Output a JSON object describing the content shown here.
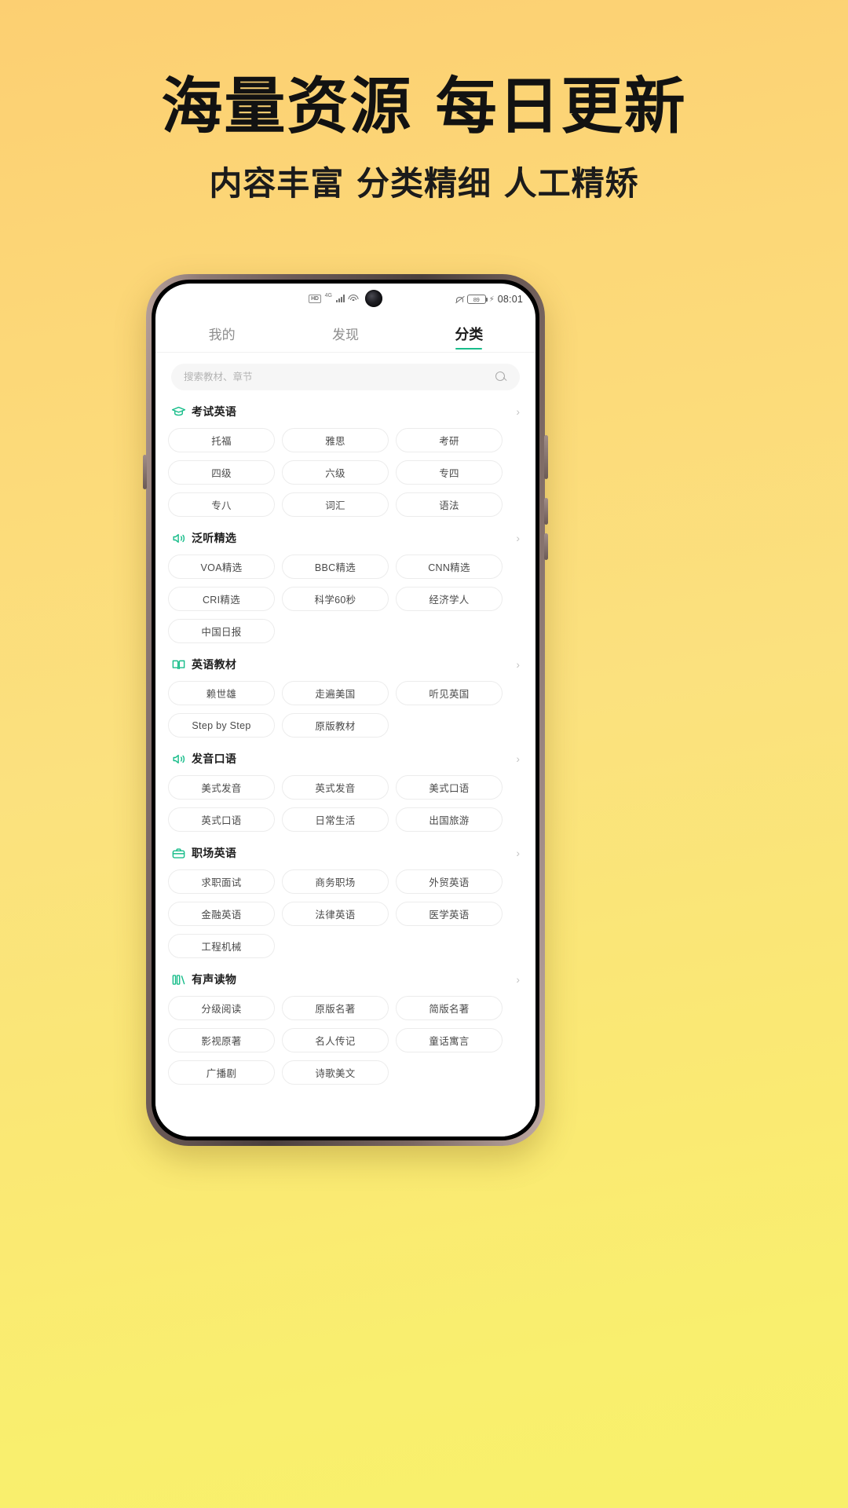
{
  "promo": {
    "title": "海量资源 每日更新",
    "subtitle": "内容丰富 分类精细 人工精矫",
    "bg_start": "#fccf72",
    "bg_end": "#f8f06a"
  },
  "statusbar": {
    "hd_badge": "HD",
    "network": "4G",
    "battery_percent": "89",
    "charging_icon": "⚡",
    "time": "08:01",
    "mute_icon": "mute-icon",
    "wifi_icon": "wifi-icon",
    "camera_icon": "front-camera"
  },
  "tabs": [
    {
      "label": "我的",
      "active": false
    },
    {
      "label": "发现",
      "active": false
    },
    {
      "label": "分类",
      "active": true
    }
  ],
  "accent_color": "#18bd8a",
  "search": {
    "placeholder": "搜索教材、章节",
    "value": "",
    "icon": "search-icon"
  },
  "sections": [
    {
      "title": "考试英语",
      "icon": "graduation-cap-icon",
      "arrow": "›",
      "chips": [
        "托福",
        "雅思",
        "考研",
        "四级",
        "六级",
        "专四",
        "专八",
        "词汇",
        "语法"
      ]
    },
    {
      "title": "泛听精选",
      "icon": "speaker-icon",
      "arrow": "›",
      "chips": [
        "VOA精选",
        "BBC精选",
        "CNN精选",
        "CRI精选",
        "科学60秒",
        "经济学人",
        "中国日报"
      ]
    },
    {
      "title": "英语教材",
      "icon": "open-book-icon",
      "arrow": "›",
      "chips": [
        "赖世雄",
        "走遍美国",
        "听见英国",
        "Step by Step",
        "原版教材"
      ]
    },
    {
      "title": "发音口语",
      "icon": "speaker-icon",
      "arrow": "›",
      "chips": [
        "美式发音",
        "英式发音",
        "美式口语",
        "英式口语",
        "日常生活",
        "出国旅游"
      ]
    },
    {
      "title": "职场英语",
      "icon": "briefcase-icon",
      "arrow": "›",
      "chips": [
        "求职面试",
        "商务职场",
        "外贸英语",
        "金融英语",
        "法律英语",
        "医学英语",
        "工程机械"
      ]
    },
    {
      "title": "有声读物",
      "icon": "audio-book-icon",
      "arrow": "›",
      "chips": [
        "分级阅读",
        "原版名著",
        "简版名著",
        "影视原著",
        "名人传记",
        "童话寓言",
        "广播剧",
        "诗歌美文"
      ]
    }
  ]
}
